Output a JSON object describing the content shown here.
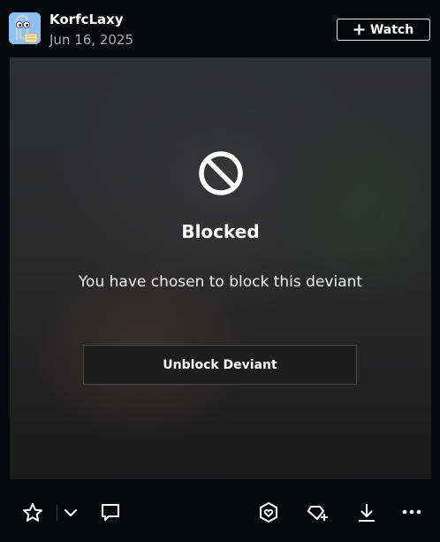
{
  "header": {
    "author_name": "KorfcLaxy",
    "post_date": "Jun 16, 2025",
    "watch_label": "Watch"
  },
  "blocked": {
    "title": "Blocked",
    "message": "You have chosen to block this deviant",
    "unblock_label": "Unblock Deviant"
  },
  "actions": {
    "icons": [
      "star-icon",
      "chevron-down-icon",
      "comment-icon",
      "badge-icon",
      "collection-add-icon",
      "download-icon",
      "more-icon"
    ]
  },
  "colors": {
    "background": "#06070a",
    "text_primary": "#ffffff",
    "text_secondary": "#a8acb2",
    "button_bg": "#1e1d1e"
  }
}
